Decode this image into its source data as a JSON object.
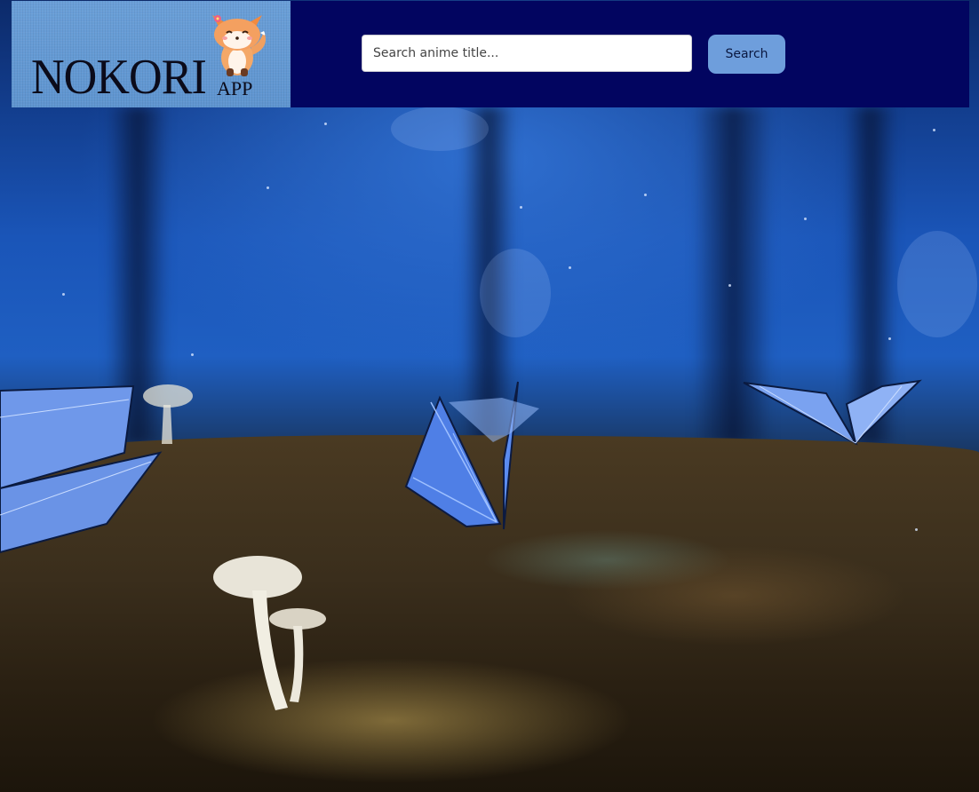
{
  "header": {
    "logo": {
      "title": "NOKORI",
      "subtitle": "APP",
      "mascot_icon": "fox-mascot-icon"
    },
    "search": {
      "placeholder": "Search anime title...",
      "value": "",
      "button_label": "Search"
    }
  },
  "background": {
    "description_icon": "forest-butterflies-background"
  },
  "colors": {
    "header_bg": "#020560",
    "logo_bg": "#6a9fd8",
    "button_bg": "#6e9edc"
  }
}
